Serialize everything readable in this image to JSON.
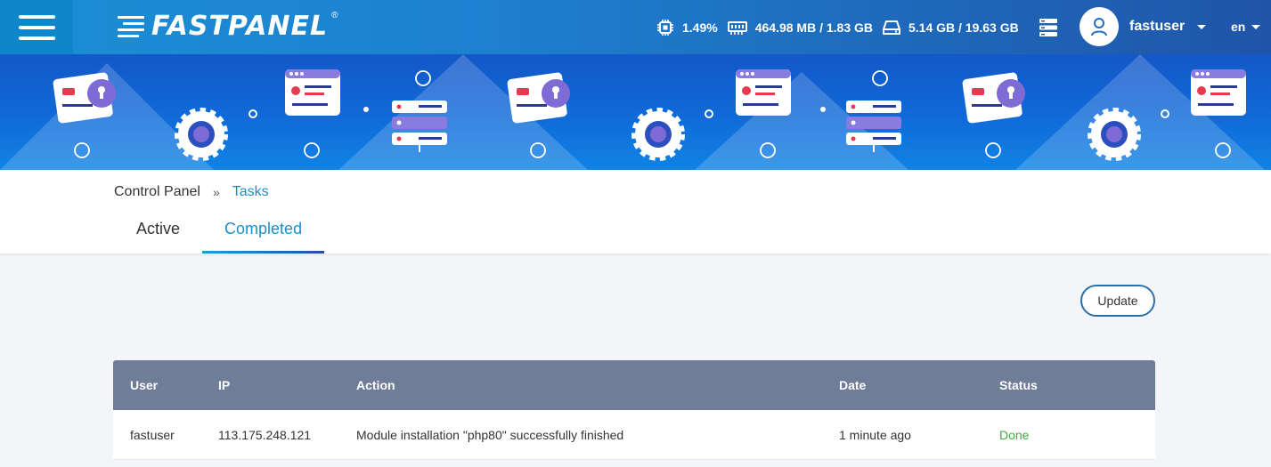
{
  "app": {
    "logo": "FASTPANEL",
    "logo_mark": "®"
  },
  "topbar": {
    "cpu": "1.49%",
    "ram": "464.98 MB / 1.83 GB",
    "disk": "5.14 GB / 19.63 GB",
    "username": "fastuser",
    "lang": "en"
  },
  "breadcrumb": {
    "home": "Control Panel",
    "separator": "»",
    "current": "Tasks"
  },
  "tabs": [
    {
      "label": "Active"
    },
    {
      "label": "Completed"
    }
  ],
  "toolbar": {
    "update_label": "Update"
  },
  "table": {
    "columns": [
      "User",
      "IP",
      "Action",
      "Date",
      "Status"
    ],
    "rows": [
      {
        "user": "fastuser",
        "ip": "113.175.248.121",
        "action": "Module installation \"php80\" successfully finished",
        "date": "1 minute ago",
        "status": "Done"
      }
    ]
  },
  "colors": {
    "accent": "#1a8fc9",
    "header_bg": "#6f7d99",
    "status_done": "#46a846"
  }
}
